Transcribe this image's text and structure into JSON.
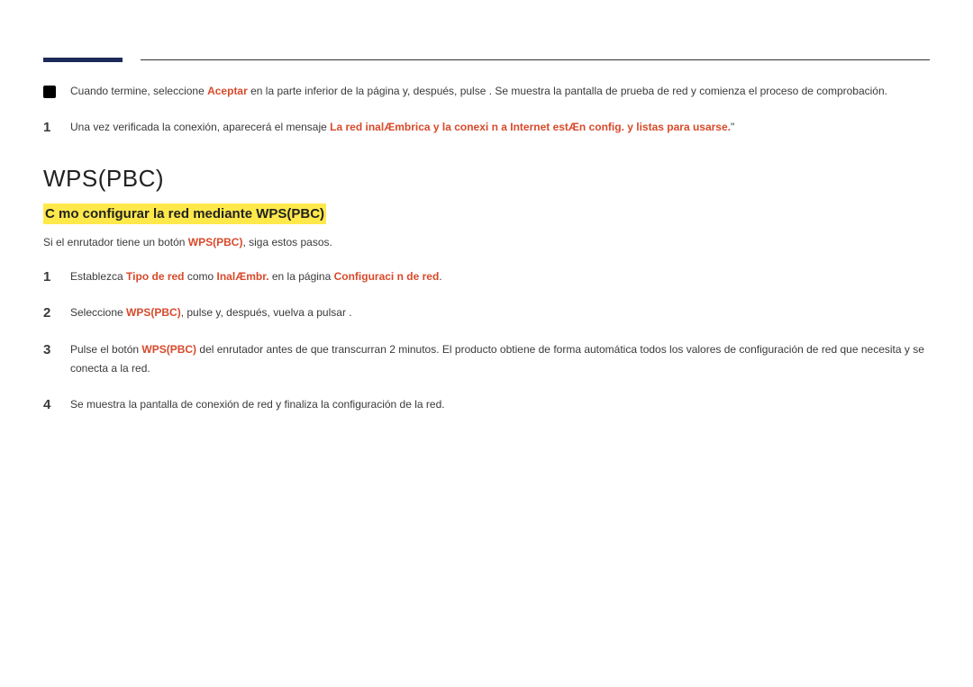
{
  "block1": {
    "pre": "Cuando termine, seleccione ",
    "aceptar": "Aceptar",
    "post": " en la parte inferior de la página y, después, pulse . Se muestra la pantalla de prueba de red y comienza el proceso de comprobación."
  },
  "block2": {
    "num": "1",
    "pre": "Una vez verificada la conexión, aparecerá el mensaje ",
    "msg": "La red inalÆmbrica y la conexi n a Internet estÆn config. y listas para usarse.",
    "post": "\""
  },
  "section_title": "WPS(PBC)",
  "subheading": "C mo configurar la red mediante WPS(PBC)",
  "intro": {
    "pre": "Si el enrutador tiene un botón ",
    "wps": "WPS(PBC)",
    "post": ", siga estos pasos."
  },
  "steps": [
    {
      "num": "1",
      "parts": [
        {
          "t": "Establezca "
        },
        {
          "t": "Tipo de red",
          "red": true
        },
        {
          "t": " como "
        },
        {
          "t": "InalÆmbr.",
          "red": true
        },
        {
          "t": " en la página "
        },
        {
          "t": "Configuraci n de red",
          "red": true
        },
        {
          "t": "."
        }
      ]
    },
    {
      "num": "2",
      "parts": [
        {
          "t": "Seleccione "
        },
        {
          "t": "WPS(PBC)",
          "red": true
        },
        {
          "t": ", pulse      y, después, vuelva a pulsar       ."
        }
      ]
    },
    {
      "num": "3",
      "parts": [
        {
          "t": "Pulse el botón "
        },
        {
          "t": "WPS(PBC)",
          "red": true
        },
        {
          "t": " del enrutador antes de que transcurran 2 minutos. El producto obtiene de forma automática todos los valores de configuración de red que necesita y se conecta a la red."
        }
      ]
    },
    {
      "num": "4",
      "parts": [
        {
          "t": "Se muestra la pantalla de conexión de red y finaliza la configuración de la red."
        }
      ]
    }
  ]
}
